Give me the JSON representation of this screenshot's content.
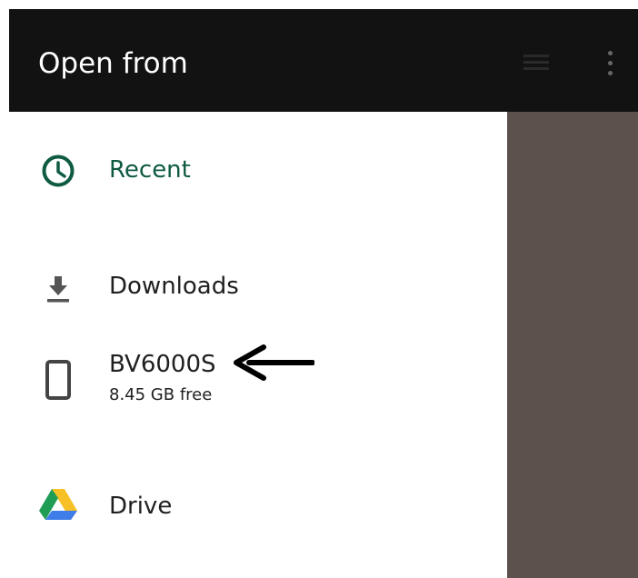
{
  "header": {
    "title": "Open from"
  },
  "sidebar": {
    "items": [
      {
        "label": "Recent",
        "icon": "clock-icon",
        "selected": true,
        "color": "#0f5a43"
      },
      {
        "label": "Downloads",
        "icon": "download-icon"
      },
      {
        "label": "BV6000S",
        "sublabel": "8.45 GB free",
        "icon": "phone-icon"
      },
      {
        "label": "Drive",
        "icon": "google-drive-icon"
      }
    ]
  },
  "annotation": {
    "icon": "left-arrow-icon",
    "color": "#000000"
  },
  "colors": {
    "header_bg": "#121212",
    "accent": "#0f5a43",
    "backdrop": "#5c514c"
  }
}
